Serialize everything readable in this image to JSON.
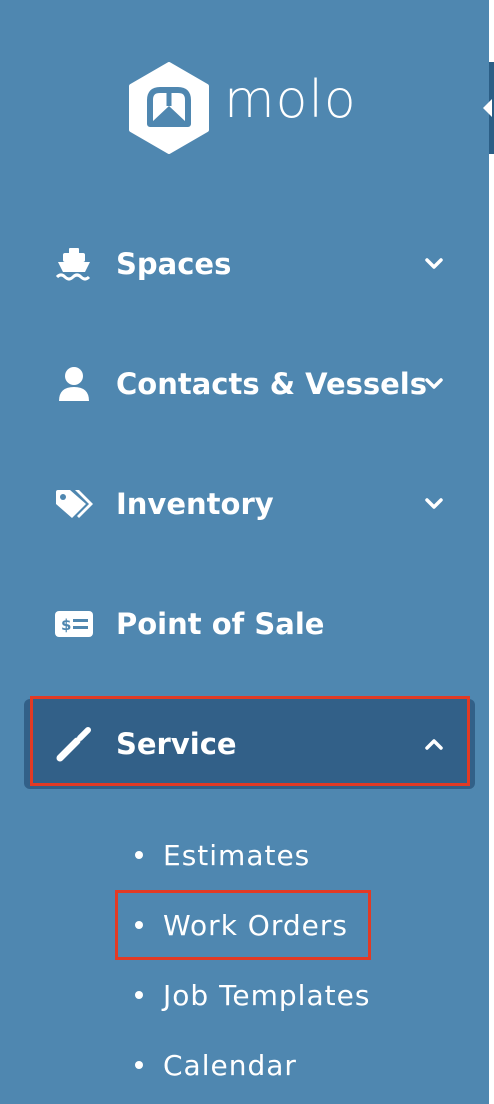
{
  "brand": {
    "name": "molo",
    "logo_icon": "molo-hex-logo"
  },
  "nav": [
    {
      "id": "spaces",
      "label": "Spaces",
      "icon": "ship-icon",
      "expandable": true,
      "expanded": false
    },
    {
      "id": "contacts",
      "label": "Contacts & Vessels",
      "icon": "user-icon",
      "expandable": true,
      "expanded": false
    },
    {
      "id": "inventory",
      "label": "Inventory",
      "icon": "tags-icon",
      "expandable": true,
      "expanded": false
    },
    {
      "id": "pos",
      "label": "Point of Sale",
      "icon": "money-card-icon",
      "expandable": false,
      "expanded": false
    },
    {
      "id": "service",
      "label": "Service",
      "icon": "wrench-icon",
      "expandable": true,
      "expanded": true,
      "active": true
    }
  ],
  "service_submenu": [
    {
      "label": "Estimates"
    },
    {
      "label": "Work Orders",
      "highlighted": true
    },
    {
      "label": "Job Templates"
    },
    {
      "label": "Calendar"
    }
  ],
  "colors": {
    "sidebar_bg": "#4f87b0",
    "active_bg": "#326088",
    "highlight": "#e23a24",
    "text": "#ffffff"
  }
}
